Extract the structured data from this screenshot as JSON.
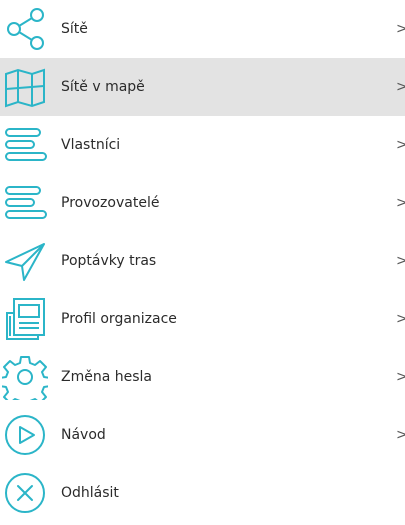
{
  "menu": {
    "accent_color": "#2bb5c8",
    "active_background": "#e3e3e3",
    "items": [
      {
        "label": "Sítě",
        "icon": "share-icon",
        "chevron": ">"
      },
      {
        "label": "Sítě v mapě",
        "icon": "map-icon",
        "chevron": ">",
        "active": true
      },
      {
        "label": "Vlastníci",
        "icon": "lines-icon",
        "chevron": ">"
      },
      {
        "label": "Provozovatelé",
        "icon": "lines-icon",
        "chevron": ">"
      },
      {
        "label": "Poptávky tras",
        "icon": "paper-plane-icon",
        "chevron": ">"
      },
      {
        "label": "Profil organizace",
        "icon": "document-icon",
        "chevron": ">"
      },
      {
        "label": "Změna hesla",
        "icon": "gear-icon",
        "chevron": ">"
      },
      {
        "label": "Návod",
        "icon": "play-circle-icon",
        "chevron": ">"
      },
      {
        "label": "Odhlásit",
        "icon": "close-circle-icon"
      }
    ]
  }
}
